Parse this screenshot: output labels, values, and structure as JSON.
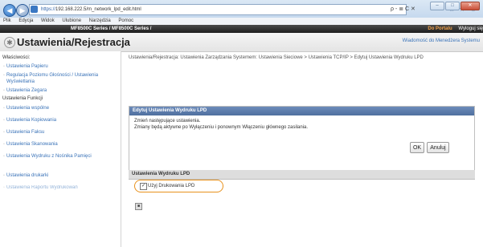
{
  "browser": {
    "address_prefix": "https://",
    "address_host": "192.168.222.5",
    "address_path": "/m_network_lpd_edit.html",
    "address_tools": "ρ - ≣ C ✕",
    "menu": [
      "Plik",
      "Edycja",
      "Widok",
      "Ulubione",
      "Narzędzia",
      "Pomoc"
    ]
  },
  "device": {
    "model": "MF8500C Series / MF8500C Series /",
    "portal_link": "Do Portalu",
    "logout": "Wyloguj się"
  },
  "header": {
    "title": "Ustawienia/Rejestracja",
    "mail_admin": "Wiadomość do Menedżera Systemu"
  },
  "sidebar": {
    "section1": "Właściwości:",
    "section1_items": [
      "Ustawienia Papieru",
      "Regulacja Poziomu Głośności / Ustawienia Wyświetlania",
      "Ustawienia Zegara"
    ],
    "section2": "Ustawienia Funkcji",
    "section2_items": [
      "Ustawienia wspólne",
      "Ustawienia Kopiowania",
      "Ustawienia Faksu",
      "Ustawienia Skanowania",
      "Ustawienia Wydruku z Nośnika Pamięci",
      "Ustawienia drukarki",
      "Ustawienia Raportu Wydrukowań"
    ]
  },
  "main": {
    "breadcrumb": "Ustawienia/Rejestracja: Ustawienia Zarządzania Systemem: Ustawienia Sieciowe > Ustawienia TCP/IP > Edytuj Ustawienia Wydruku LPD",
    "edit_panel_title": "Edytuj Ustawienia Wydruku LPD",
    "instruction_line1": "Zmień następujące ustawienia.",
    "instruction_line2": "Zmiany będą aktywne po Wyłączeniu i ponownym Włączeniu głównego zasilania.",
    "ok_label": "OK",
    "cancel_label": "Anuluj",
    "settings_panel_title": "Ustawienia Wydruku LPD",
    "use_lpd_label": "Użyj Drukowania LPD",
    "use_lpd_checked": true
  }
}
